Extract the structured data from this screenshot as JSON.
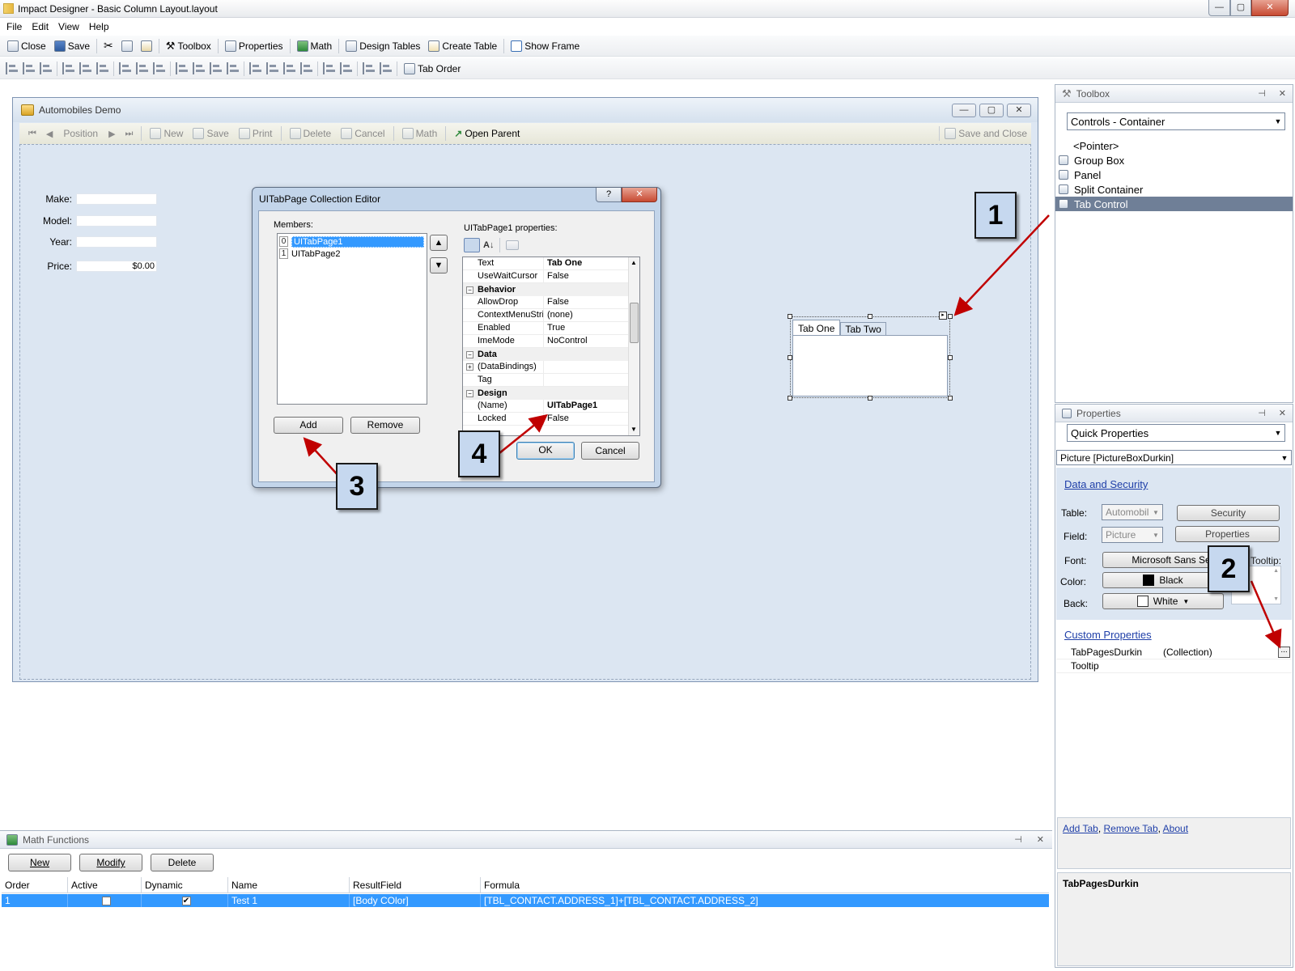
{
  "window": {
    "title": "Impact Designer - Basic Column Layout.layout",
    "controls": [
      "—",
      "▢",
      "✕"
    ]
  },
  "menu": [
    "File",
    "Edit",
    "View",
    "Help"
  ],
  "toolbar1": {
    "close": "Close",
    "save": "Save",
    "toolbox": "Toolbox",
    "properties": "Properties",
    "math": "Math",
    "design_tables": "Design Tables",
    "create_table": "Create Table",
    "show_frame": "Show Frame"
  },
  "toolbar2": {
    "tab_order": "Tab Order"
  },
  "form": {
    "title": "Automobiles Demo",
    "toolbar": {
      "position": "Position",
      "new": "New",
      "save": "Save",
      "print": "Print",
      "delete": "Delete",
      "cancel": "Cancel",
      "math": "Math",
      "open_parent": "Open Parent",
      "save_close": "Save and Close"
    },
    "fields": [
      {
        "label": "Make:",
        "value": ""
      },
      {
        "label": "Model:",
        "value": ""
      },
      {
        "label": "Year:",
        "value": ""
      },
      {
        "label": "Price:",
        "value": "$0.00"
      }
    ],
    "tabs": [
      "Tab One",
      "Tab Two"
    ]
  },
  "dialog": {
    "title": "UITabPage Collection Editor",
    "help": "?",
    "close": "✕",
    "members_label": "Members:",
    "members": [
      {
        "index": "0",
        "name": "UITabPage1"
      },
      {
        "index": "1",
        "name": "UITabPage2"
      }
    ],
    "props_label": "UITabPage1 properties:",
    "add": "Add",
    "remove": "Remove",
    "ok": "OK",
    "cancel": "Cancel",
    "grid": {
      "top": [
        {
          "k": "Text",
          "v": "Tab One"
        },
        {
          "k": "UseWaitCursor",
          "v": "False"
        }
      ],
      "behavior": {
        "title": "Behavior",
        "rows": [
          {
            "k": "AllowDrop",
            "v": "False"
          },
          {
            "k": "ContextMenuStrip",
            "v": "(none)"
          },
          {
            "k": "Enabled",
            "v": "True"
          },
          {
            "k": "ImeMode",
            "v": "NoControl"
          }
        ]
      },
      "data": {
        "title": "Data",
        "rows": [
          {
            "k": "(DataBindings)",
            "v": ""
          },
          {
            "k": "Tag",
            "v": ""
          }
        ]
      },
      "design": {
        "title": "Design",
        "rows": [
          {
            "k": "(Name)",
            "v": "UITabPage1"
          },
          {
            "k": "Locked",
            "v": "False"
          }
        ]
      }
    }
  },
  "toolbox": {
    "title": "Toolbox",
    "pin": "⊣",
    "close": "✕",
    "category": "Controls - Container",
    "items": [
      "<Pointer>",
      "Group Box",
      "Panel",
      "Split Container",
      "Tab Control"
    ]
  },
  "properties": {
    "title": "Properties",
    "pin": "⊣",
    "close": "✕",
    "mode": "Quick Properties",
    "object": "Picture [PictureBoxDurkin]",
    "data_security": "Data and Security",
    "table_label": "Table:",
    "table_value": "Automobil",
    "security": "Security",
    "field_label": "Field:",
    "field_value": "Picture",
    "properties_btn": "Properties",
    "font_label": "Font:",
    "font_value": "Microsoft Sans Serif",
    "tooltip_label": "Tooltip:",
    "color_label": "Color:",
    "color_value": "Black",
    "back_label": "Back:",
    "back_value": "White",
    "custom_properties": "Custom Properties",
    "custom": [
      {
        "k": "TabPagesDurkin",
        "v": "(Collection)"
      },
      {
        "k": "Tooltip",
        "v": ""
      }
    ],
    "links": [
      "Add Tab",
      "Remove Tab",
      "About"
    ],
    "description_title": "TabPagesDurkin"
  },
  "math_functions": {
    "title": "Math Functions",
    "new": "New",
    "modify": "Modify",
    "delete": "Delete",
    "columns": [
      "Order",
      "Active",
      "Dynamic",
      "Name",
      "ResultField",
      "Formula"
    ],
    "rows": [
      {
        "order": "1",
        "active": false,
        "dynamic": true,
        "name": "Test 1",
        "result": "[Body COlor]",
        "formula": "[TBL_CONTACT.ADDRESS_1]+[TBL_CONTACT.ADDRESS_2]"
      }
    ]
  },
  "callouts": [
    "1",
    "2",
    "3",
    "4"
  ],
  "colors": {
    "accent": "#3399ff",
    "selection": "#6f7f97",
    "callout_bg": "#c6d8ef",
    "arrow": "#c00000"
  }
}
